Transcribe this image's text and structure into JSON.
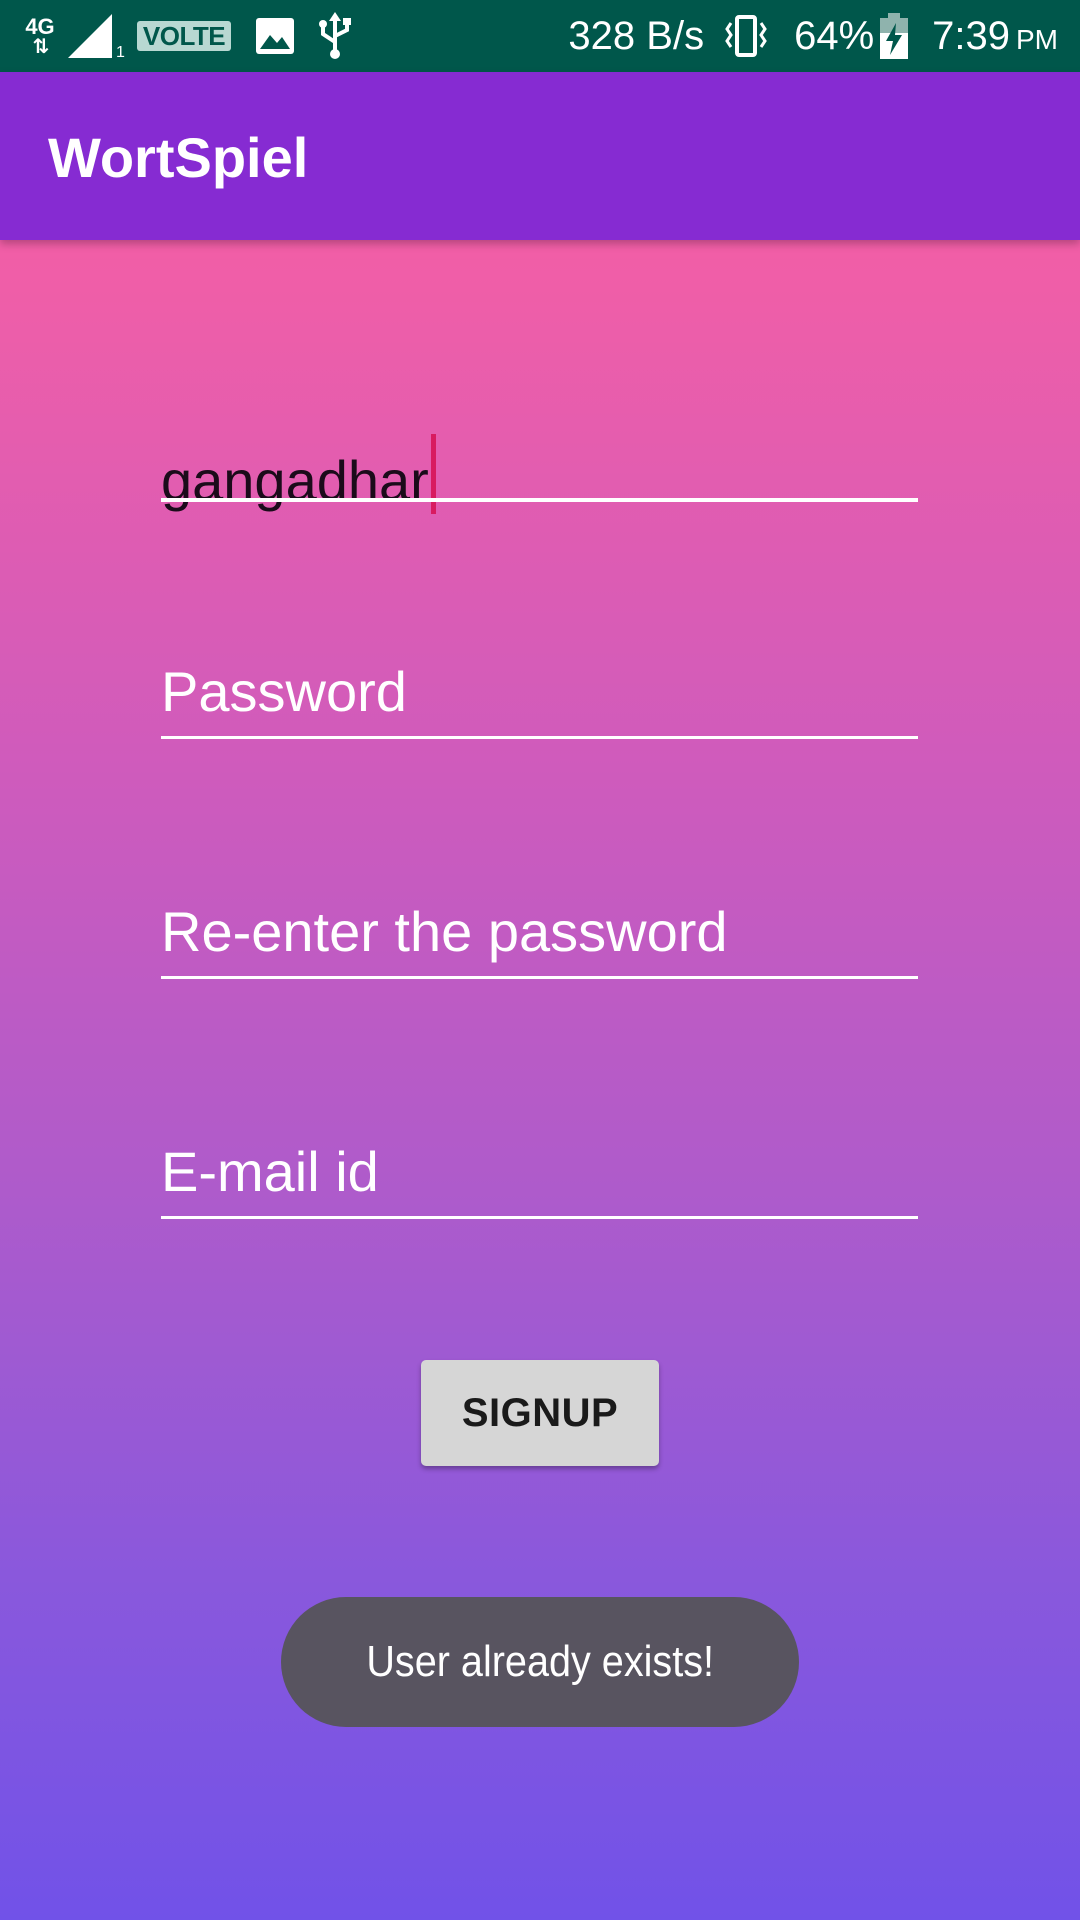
{
  "status_bar": {
    "network_type": "4G",
    "sim_slot": "1",
    "volte_label": "VOLTE",
    "data_speed": "328 B/s",
    "battery_percent": "64%",
    "time": "7:39",
    "ampm": "PM",
    "icons": [
      "network-4g-icon",
      "signal-icon",
      "image-icon",
      "usb-icon",
      "vibrate-icon",
      "battery-charging-icon"
    ]
  },
  "app_bar": {
    "title": "WortSpiel"
  },
  "form": {
    "username_value": "gangadhar",
    "password_placeholder": "Password",
    "reenter_placeholder": "Re-enter the password",
    "email_placeholder": "E-mail id",
    "signup_label": "SIGNUP"
  },
  "toast": {
    "message": "User already exists!"
  },
  "colors": {
    "status_bar": "#00574b",
    "app_bar": "#862bd2",
    "gradient_top": "#ff5f9f",
    "gradient_bottom": "#7152e8",
    "cursor": "#d81b60",
    "toast_bg": "#585460"
  }
}
